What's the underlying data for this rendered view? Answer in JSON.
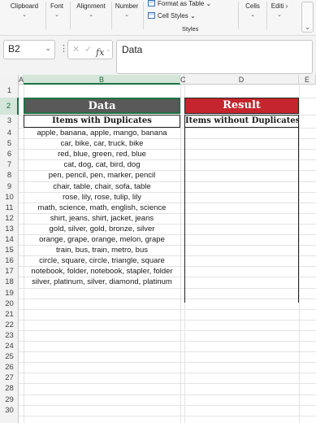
{
  "ribbon": {
    "clipboard": "Clipboard",
    "font": "Font",
    "alignment": "Alignment",
    "number": "Number",
    "format_as_table": "Format as Table",
    "cell_styles": "Cell Styles",
    "styles_caption": "Styles",
    "cells": "Cells",
    "editing": "Editi"
  },
  "formula_bar": {
    "name_box": "B2",
    "fx_label": "fx",
    "formula": "Data"
  },
  "columns": [
    "A",
    "B",
    "C",
    "D",
    "E"
  ],
  "selected_cell": "B2",
  "rows": [
    "1",
    "2",
    "3",
    "4",
    "5",
    "6",
    "7",
    "8",
    "9",
    "10",
    "11",
    "12",
    "13",
    "14",
    "15",
    "16",
    "17",
    "18",
    "19",
    "20",
    "21",
    "22",
    "23",
    "24",
    "25",
    "26",
    "27",
    "28",
    "29",
    "30"
  ],
  "table": {
    "data_header": "Data",
    "result_header": "Result",
    "data_subheader": "Items with Duplicates",
    "result_subheader": "Items without Duplicates",
    "items": [
      "apple, banana, apple, mango, banana",
      "car, bike, car, truck, bike",
      "red, blue, green, red, blue",
      "cat, dog, cat, bird, dog",
      "pen, pencil, pen, marker, pencil",
      "chair, table, chair, sofa, table",
      "rose, lily, rose, tulip, lily",
      "math, science, math, english, science",
      "shirt, jeans, shirt, jacket, jeans",
      "gold, silver, gold, bronze, silver",
      "orange, grape, orange, melon, grape",
      "train, bus, train, metro, bus",
      "circle, square, circle, triangle, square",
      "notebook, folder, notebook, stapler, folder",
      "silver, platinum, silver, diamond, platinum"
    ]
  },
  "colors": {
    "data_header_bg": "#595959",
    "result_header_bg": "#c5252c",
    "selection": "#1e7145"
  }
}
